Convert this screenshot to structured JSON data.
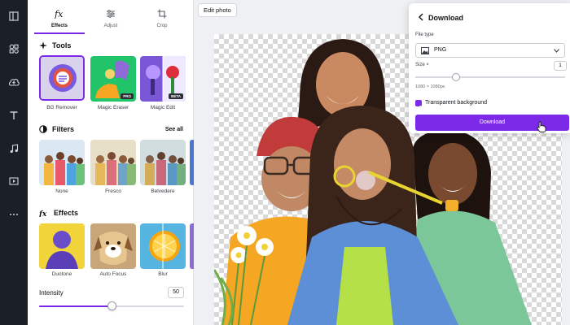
{
  "rail": {
    "icons": [
      "layout-icon",
      "elements-icon",
      "upload-icon",
      "text-icon",
      "audio-icon",
      "video-icon",
      "more-icon"
    ]
  },
  "tabs": [
    {
      "label": "Effects",
      "icon": "fx-icon",
      "active": true
    },
    {
      "label": "Adjust",
      "icon": "sliders-icon",
      "active": false
    },
    {
      "label": "Crop",
      "icon": "crop-icon",
      "active": false
    }
  ],
  "tools": {
    "heading": "Tools",
    "items": [
      {
        "label": "BG Remover"
      },
      {
        "label": "Magic Eraser",
        "badge": "PRO"
      },
      {
        "label": "Magic Edit",
        "badge": "BETA"
      }
    ]
  },
  "filters": {
    "heading": "Filters",
    "see_all": "See all",
    "items": [
      {
        "label": "None"
      },
      {
        "label": "Fresco"
      },
      {
        "label": "Belvedere"
      }
    ]
  },
  "effects": {
    "heading": "Effects",
    "items": [
      {
        "label": "Duotone"
      },
      {
        "label": "Auto Focus"
      },
      {
        "label": "Blur"
      }
    ]
  },
  "intensity": {
    "label": "Intensity",
    "value": "50",
    "fraction": 0.5
  },
  "toolbar": {
    "edit_photo": "Edit photo"
  },
  "download": {
    "title": "Download",
    "file_type_label": "File type",
    "file_type_value": "PNG",
    "size_label": "Size ×",
    "size_value": "1",
    "dimensions": "1080 × 1080px",
    "transparent_label": "Transparent background",
    "button_label": "Download"
  },
  "colors": {
    "accent": "#7d2ae8",
    "rail": "#1b1f26"
  }
}
